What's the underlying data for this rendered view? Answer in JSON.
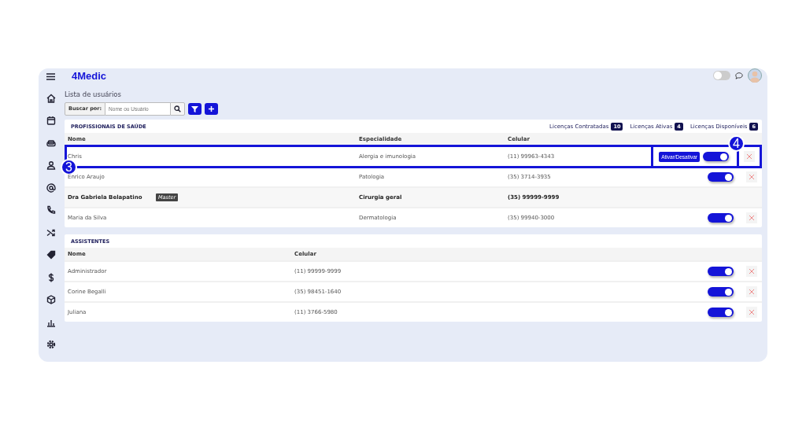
{
  "brand": "4Medic",
  "theme_toggle": {
    "on": false
  },
  "page_title": "Lista de usuários",
  "search": {
    "label": "Buscar por:",
    "placeholder": "Nome ou Usuário"
  },
  "professionals": {
    "title": "PROFISSIONAIS DE SAÚDE",
    "licenses": [
      {
        "label": "Licenças Contratadas",
        "count": "10"
      },
      {
        "label": "Licenças Ativas",
        "count": "4"
      },
      {
        "label": "Licenças Disponíveis",
        "count": "6"
      }
    ],
    "columns": [
      "Nome",
      "Especialidade",
      "Celular"
    ],
    "rows": [
      {
        "name": "Chris",
        "specialty": "Alergia e imunologia",
        "phone": "(11) 99963-4343",
        "master": false,
        "active": true,
        "highlighted": true,
        "tooltip": "Ativar/Desativar",
        "callouts": [
          "3",
          "4"
        ]
      },
      {
        "name": "Enrico Araujo",
        "specialty": "Patologia",
        "phone": "(35) 3714-3935",
        "master": false,
        "active": true,
        "highlighted": false
      },
      {
        "name": "Dra Gabriela Belapatino",
        "badge": "Master",
        "specialty": "Cirurgia geral",
        "phone": "(35) 99999-9999",
        "master": true,
        "highlighted": false
      },
      {
        "name": "Maria da Silva",
        "specialty": "Dermatologia",
        "phone": "(35) 99940-3000",
        "master": false,
        "active": true,
        "highlighted": false
      }
    ]
  },
  "assistants": {
    "title": "ASSISTENTES",
    "columns": [
      "Nome",
      "Celular"
    ],
    "rows": [
      {
        "name": "Administrador",
        "phone": "(11) 99999-9999",
        "active": true
      },
      {
        "name": "Corine Begalli",
        "phone": "(35) 98451-1640",
        "active": true
      },
      {
        "name": "Juliana",
        "phone": "(11) 3766-5980",
        "active": true
      }
    ]
  }
}
